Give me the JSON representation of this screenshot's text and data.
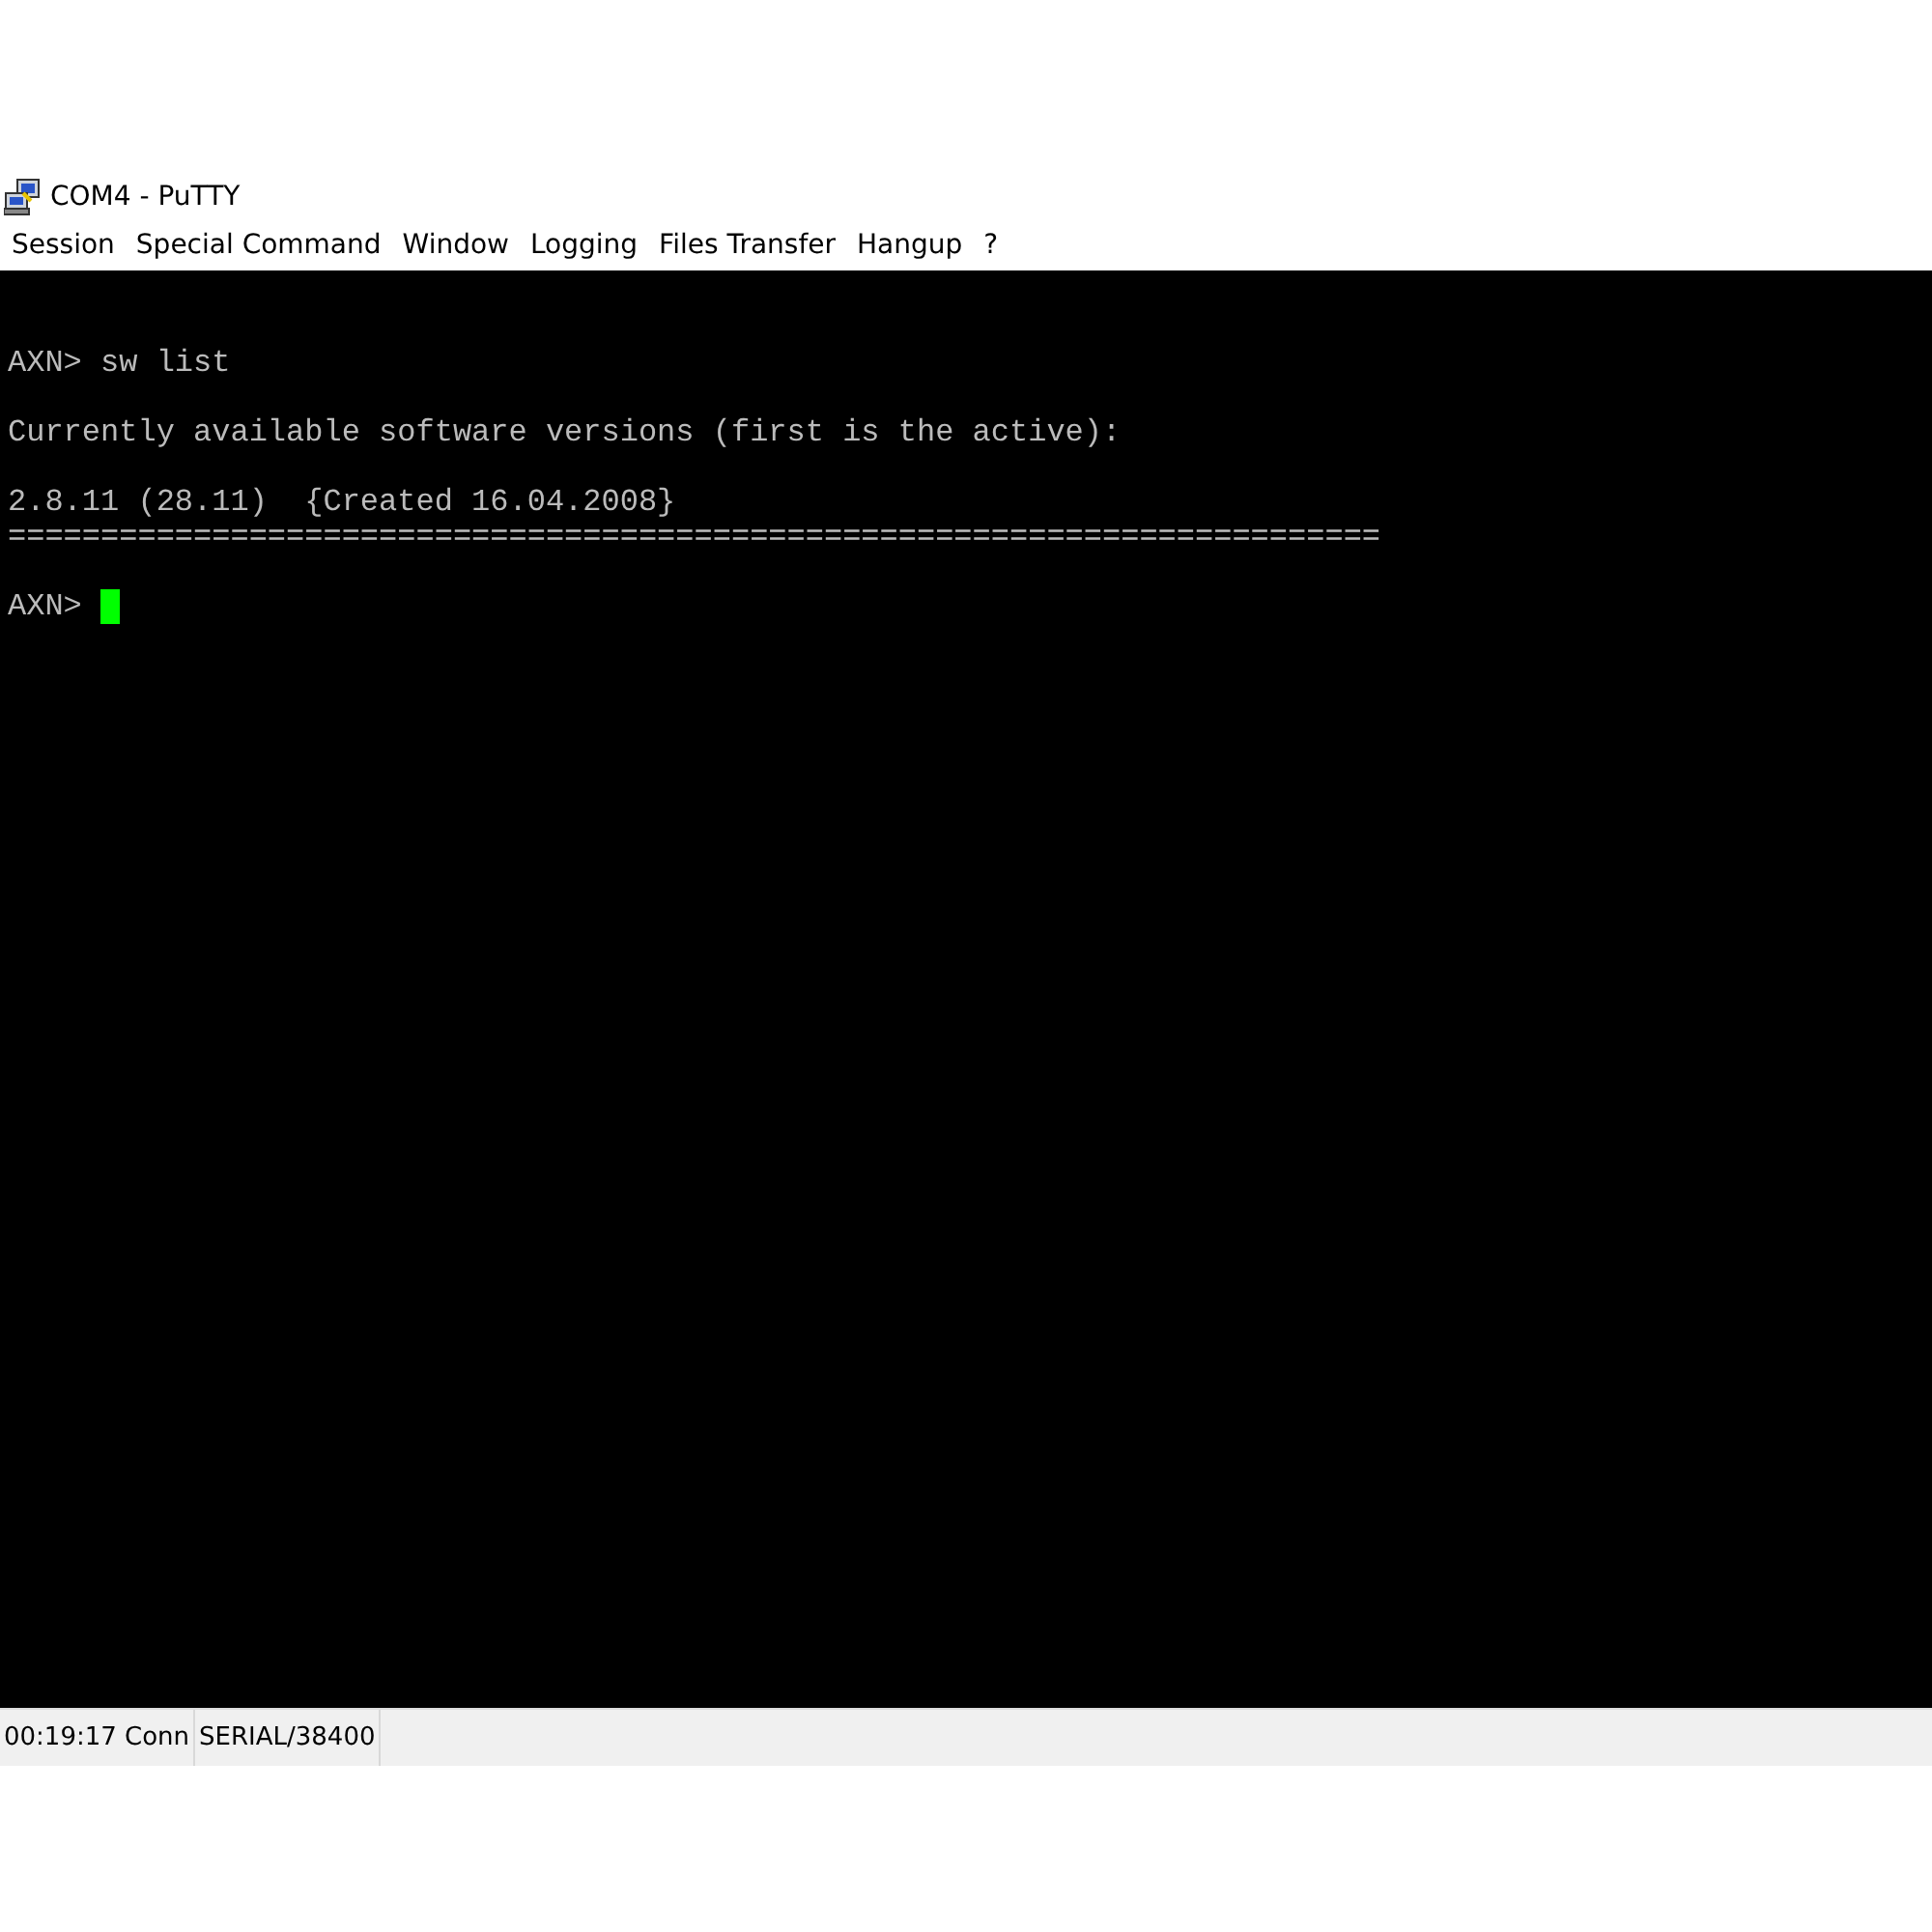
{
  "window": {
    "title": "COM4 - PuTTY"
  },
  "menu": [
    "Session",
    "Special Command",
    "Window",
    "Logging",
    "Files Transfer",
    "Hangup",
    "?"
  ],
  "terminal": {
    "blocks": [
      [
        "AXN> sw list"
      ],
      [
        "Currently available software versions (first is the active):"
      ],
      [
        "2.8.11 (28.11)  {Created 16.04.2008}",
        "=========================================================================="
      ]
    ],
    "prompt": "AXN> ",
    "cursor": true
  },
  "status_bar": [
    "00:19:17 Conn",
    "SERIAL/38400"
  ]
}
